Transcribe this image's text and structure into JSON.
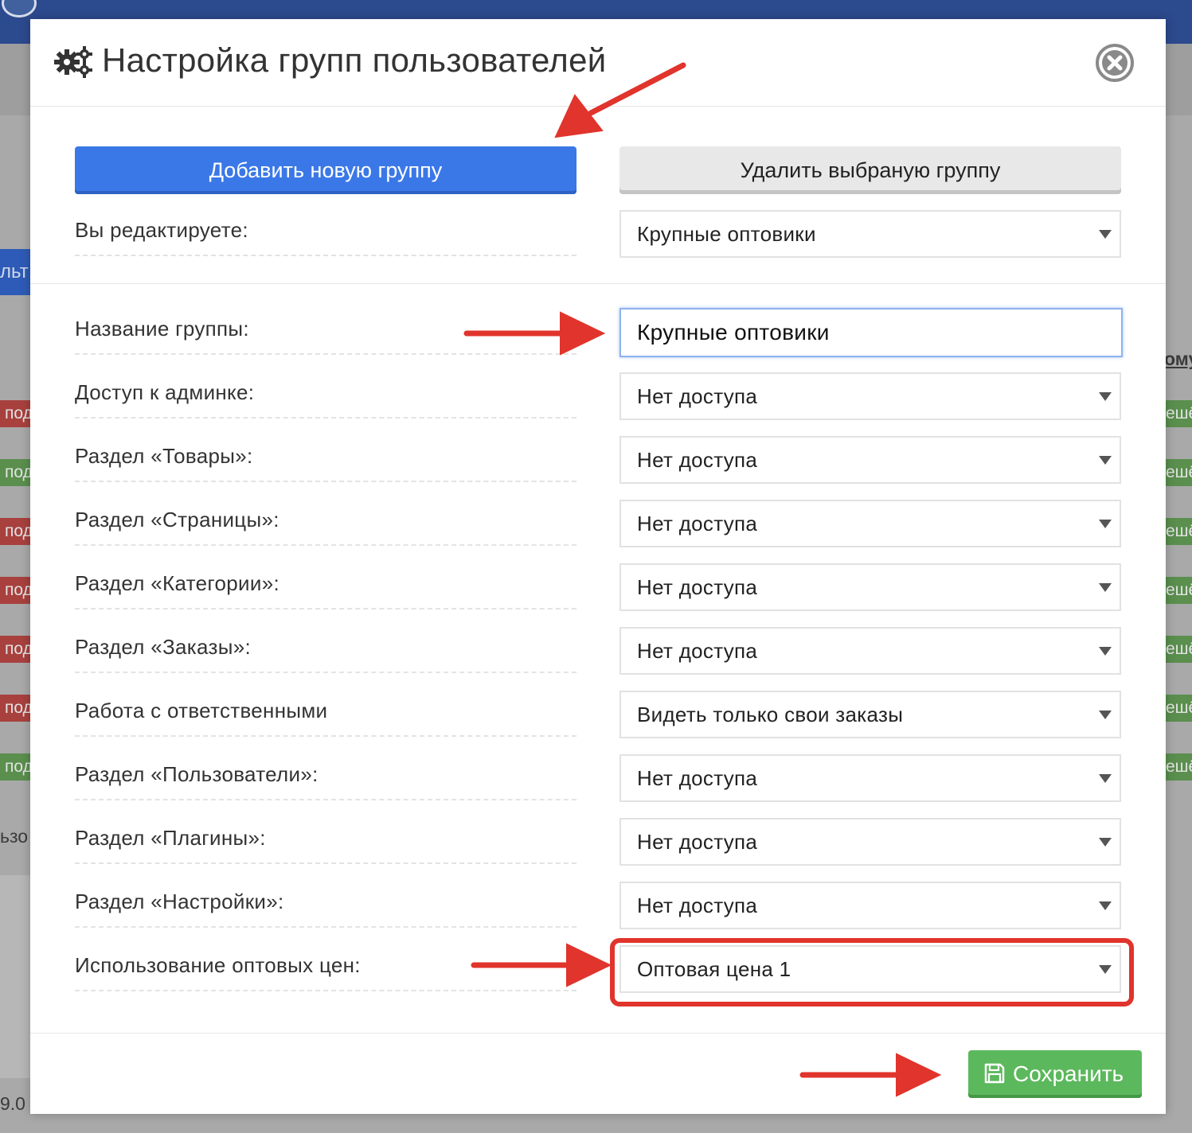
{
  "background": {
    "left_button_text": "льт",
    "left_tags": [
      "под",
      "подт",
      "под",
      "под",
      "под",
      "под",
      "подт"
    ],
    "right_tags": [
      "ешё",
      "ешё",
      "ешё",
      "ешё",
      "ешё",
      "ешё",
      "ешё"
    ],
    "right_text": "ому",
    "left_text": "ьзо",
    "version_text": "9.0"
  },
  "modal": {
    "title": "Настройка групп пользователей",
    "add_button": "Добавить новую группу",
    "delete_button": "Удалить выбраную группу",
    "editing_label": "Вы редактируете:",
    "editing_value": "Крупные оптовики",
    "group_name_label": "Название группы:",
    "group_name_value": "Крупные оптовики",
    "rows": [
      {
        "label": "Доступ к админке:",
        "value": "Нет доступа"
      },
      {
        "label": "Раздел «Товары»:",
        "value": "Нет доступа"
      },
      {
        "label": "Раздел «Страницы»:",
        "value": "Нет доступа"
      },
      {
        "label": "Раздел «Категории»:",
        "value": "Нет доступа"
      },
      {
        "label": "Раздел «Заказы»:",
        "value": "Нет доступа"
      },
      {
        "label": "Работа с ответственными",
        "value": "Видеть только свои заказы"
      },
      {
        "label": "Раздел «Пользователи»:",
        "value": "Нет доступа"
      },
      {
        "label": "Раздел «Плагины»:",
        "value": "Нет доступа"
      },
      {
        "label": "Раздел «Настройки»:",
        "value": "Нет доступа"
      },
      {
        "label": "Использование оптовых цен:",
        "value": "Оптовая цена 1"
      }
    ],
    "save_button": "Сохранить"
  },
  "colors": {
    "primary": "#3b78e7",
    "success": "#5cb85c",
    "annotation": "#e0342c",
    "header_bar": "#2c4a8e"
  }
}
